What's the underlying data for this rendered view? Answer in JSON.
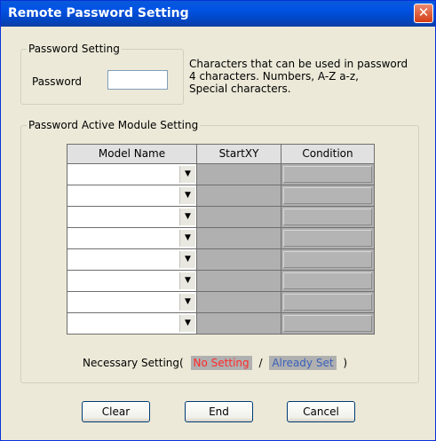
{
  "window": {
    "title": "Remote Password Setting"
  },
  "password_setting": {
    "group_label": "Password Setting",
    "field_label": "Password",
    "value": "",
    "hint_lines": [
      "Characters that can be used in password",
      "4 characters. Numbers, A-Z a-z,",
      "Special characters."
    ]
  },
  "module_setting": {
    "group_label": "Password Active Module Setting",
    "columns": [
      "Model Name",
      "StartXY",
      "Condition"
    ],
    "rows": [
      {
        "model": "",
        "startxy": "",
        "condition": ""
      },
      {
        "model": "",
        "startxy": "",
        "condition": ""
      },
      {
        "model": "",
        "startxy": "",
        "condition": ""
      },
      {
        "model": "",
        "startxy": "",
        "condition": ""
      },
      {
        "model": "",
        "startxy": "",
        "condition": ""
      },
      {
        "model": "",
        "startxy": "",
        "condition": ""
      },
      {
        "model": "",
        "startxy": "",
        "condition": ""
      },
      {
        "model": "",
        "startxy": "",
        "condition": ""
      }
    ]
  },
  "necessary_setting": {
    "prefix": "Necessary Setting(",
    "no_setting": "No Setting",
    "separator": "/",
    "already_set": "Already Set",
    "suffix": ")"
  },
  "buttons": {
    "clear": "Clear",
    "end": "End",
    "cancel": "Cancel"
  },
  "colors": {
    "titlebar": "#0a5ad7",
    "no_setting": "#ff2a2a",
    "already_set": "#3a60b8",
    "disabled_cell": "#b0b0b0"
  }
}
